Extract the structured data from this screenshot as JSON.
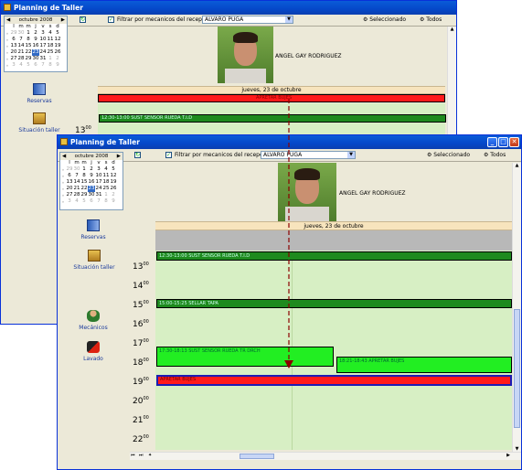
{
  "app": {
    "title": "Planning de Taller",
    "filter_label": "Filtrar por mecanicos del recepcionista",
    "filter_value": "ALVARO PUGA",
    "btn_selected": "Seleccionado",
    "btn_all": "Todos"
  },
  "calendar": {
    "month": "octubre 2008",
    "days_header": [
      "l",
      "m",
      "m",
      "j",
      "v",
      "s",
      "d"
    ],
    "weeks": [
      [
        "29",
        "30",
        "1",
        "2",
        "3",
        "4",
        "5"
      ],
      [
        "6",
        "7",
        "8",
        "9",
        "10",
        "11",
        "12"
      ],
      [
        "13",
        "14",
        "15",
        "16",
        "17",
        "18",
        "19"
      ],
      [
        "20",
        "21",
        "22",
        "23",
        "24",
        "25",
        "26"
      ],
      [
        "27",
        "28",
        "29",
        "30",
        "31",
        "1",
        "2"
      ],
      [
        "3",
        "4",
        "5",
        "6",
        "7",
        "8",
        "9"
      ]
    ]
  },
  "sidebar": {
    "reservas": "Reservas",
    "situacion": "Situación taller",
    "mecanicos": "Mecánicos",
    "lavado": "Lavado"
  },
  "mechanic": "ANGEL GAY RODRIGUEZ",
  "date_label": "jueves, 23 de octubre",
  "hours": [
    "13",
    "14",
    "15",
    "16",
    "17",
    "18",
    "19",
    "20",
    "21",
    "22"
  ],
  "hour_suffix": "00",
  "events": {
    "sust_sensor_top": "12:30-13:00 SUST SENSOR RUEDA T.I.D",
    "sellar_tapa": "15:00-15:25 SELLAR TAPA",
    "sust_sensor_tr": "17:30-18:13 SUST SENSOR RUEDA TR DRCH",
    "apretar_green": "18:21-18:43 APRETAR BUJES",
    "apretar_red": "APRETAR BUJES"
  },
  "colors": {
    "title_blue": "#0548c9",
    "event_dark_green": "#1e8a1e",
    "event_bright_green": "#22ee22",
    "event_red": "#ff1a1a",
    "grid_green": "#d7efc4"
  }
}
